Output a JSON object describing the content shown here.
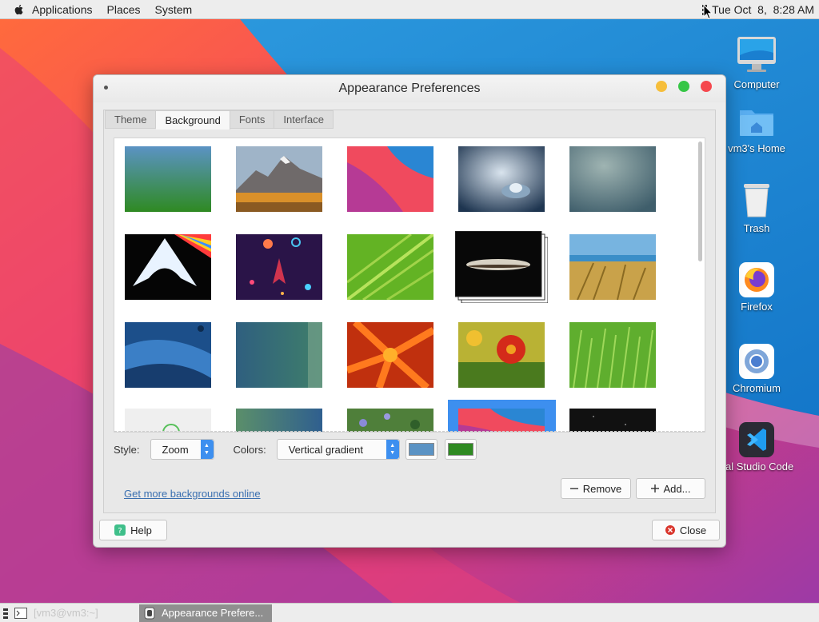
{
  "top_panel": {
    "apple_icon": "apple-icon",
    "menus": [
      "Applications",
      "Places",
      "System"
    ],
    "clock": "Tue Oct  8,  8:28 AM"
  },
  "desktop_icons": [
    {
      "label": "Computer",
      "icon": "computer-icon"
    },
    {
      "label": "vm3's Home",
      "icon": "home-folder-icon"
    },
    {
      "label": "Trash",
      "icon": "trash-icon"
    },
    {
      "label": "Firefox",
      "icon": "firefox-icon"
    },
    {
      "label": "Chromium",
      "icon": "chromium-icon"
    },
    {
      "label": "ual Studio Code",
      "icon": "vscode-icon"
    }
  ],
  "window": {
    "title": "Appearance Preferences",
    "tabs": [
      "Theme",
      "Background",
      "Fonts",
      "Interface"
    ],
    "active_tab": "Background",
    "wallpapers": [
      "green-blue-gradient",
      "mountain-lake",
      "red-waves",
      "water-drop",
      "grey-blue-blur",
      "arch-prism",
      "space-rocket",
      "green-leaf",
      "sombrero-galaxy",
      "beach-grass",
      "blue-abstract",
      "teal-gradient-dots",
      "orange-flower",
      "red-flower",
      "green-grass",
      "green-swirl",
      "teal-gradient",
      "blue-flowers",
      "red-wave-selected",
      "dark-stars"
    ],
    "selected_wallpaper": "red-wave-selected",
    "controls": {
      "style_label": "Style:",
      "style_value": "Zoom",
      "colors_label": "Colors:",
      "colors_value": "Vertical gradient",
      "color1": "#5b93c4",
      "color2": "#2f8a22"
    },
    "link": "Get more backgrounds online",
    "remove_label": "Remove",
    "add_label": "Add...",
    "help_label": "Help",
    "close_label": "Close",
    "traffic_lights": {
      "minimize": "#f6be3b",
      "maximize": "#36c646",
      "close": "#f5484e"
    }
  },
  "taskbar": {
    "tasks": [
      {
        "label": "[vm3@vm3:~]",
        "icon": "terminal-icon",
        "active": false
      },
      {
        "label": "Appearance Prefere...",
        "icon": "appearance-icon",
        "active": true
      }
    ]
  }
}
